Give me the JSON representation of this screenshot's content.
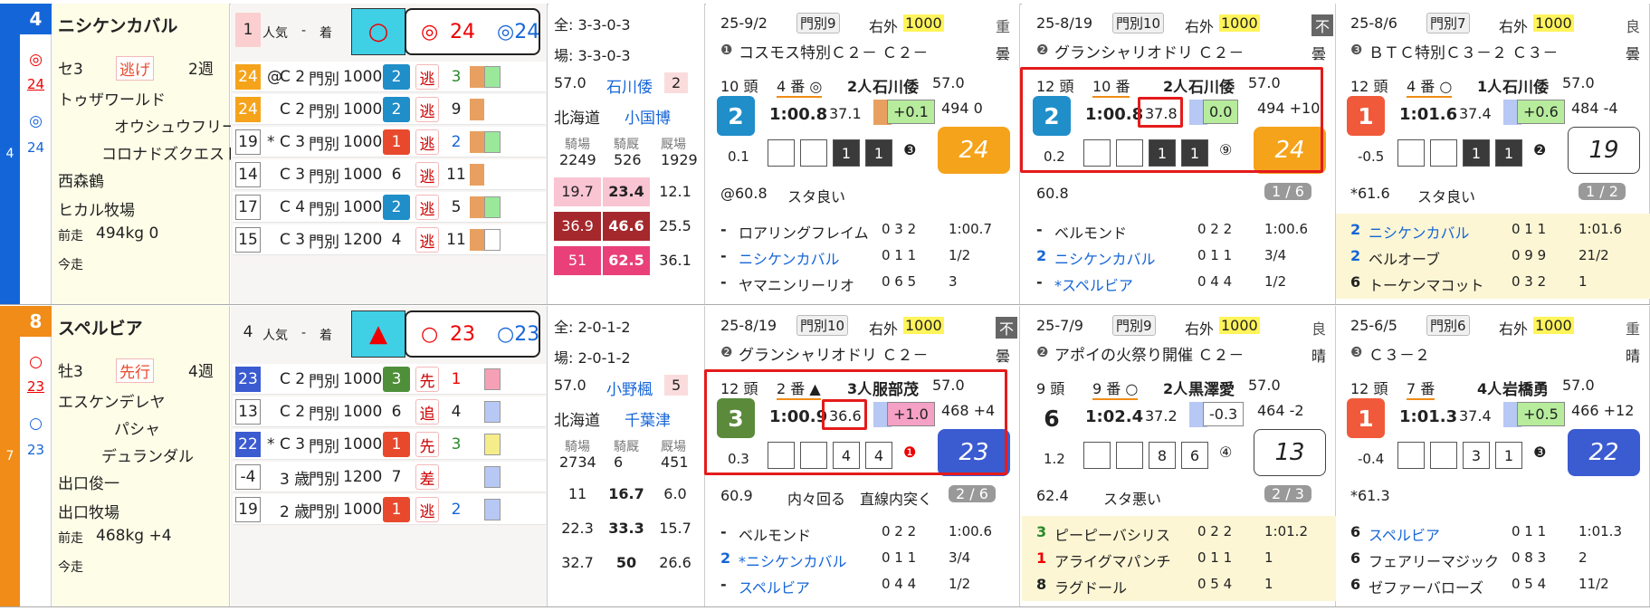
{
  "horses": [
    {
      "num": "4",
      "color": "#1466d8",
      "strip_label": "4",
      "mark": "◎",
      "mark_val": "24",
      "mark2": "◎",
      "mark2_val": "24",
      "name": "ニシケンカバル",
      "sex_age": "セ3",
      "style": "逃げ",
      "interval": "2週",
      "sire": "トゥザワールド",
      "dam": "オウシュウフリート",
      "dam_sire": "コロナドズクエスト",
      "trainer": "西森鶴",
      "owner": "ヒカル牧場",
      "weight_label": "前走",
      "weight": "494kg  0",
      "bottom_label": "今走",
      "pop": "1",
      "pop_label": "人気",
      "pop_dash": "-",
      "pop_chaku": "着",
      "pop_mark": "○",
      "big_marks": [
        "◎",
        "24",
        "◎24"
      ],
      "prev": [
        {
          "a": "24",
          "ac": "#f5a31b",
          "b": "@",
          "c": "C 2",
          "d": "門別",
          "e": "1000",
          "f": "2",
          "fc": "#1f8ec9",
          "g": "逃",
          "h": "3",
          "hc": "#2a8a2a",
          "w1": "#e8a060",
          "w2": "#9be89b"
        },
        {
          "a": "24",
          "ac": "#f5a31b",
          "b": "",
          "c": "C 2",
          "d": "門別",
          "e": "1000",
          "f": "2",
          "fc": "#1f8ec9",
          "g": "逃",
          "h": "9",
          "hc": "#222",
          "w1": "#e8a060",
          "w2": ""
        },
        {
          "a": "19",
          "ac": "",
          "b": "*",
          "c": "C 3",
          "d": "門別",
          "e": "1000",
          "f": "1",
          "fc": "#e8492c",
          "g": "逃",
          "h": "2",
          "hc": "#1565d8",
          "w1": "#e8a060",
          "w2": "#9be89b"
        },
        {
          "a": "14",
          "ac": "",
          "b": "",
          "c": "C 3",
          "d": "門別",
          "e": "1000",
          "f": "6",
          "fc": "",
          "g": "逃",
          "h": "11",
          "hc": "#222",
          "w1": "#e8a060",
          "w2": ""
        },
        {
          "a": "17",
          "ac": "",
          "b": "",
          "c": "C 4",
          "d": "門別",
          "e": "1000",
          "f": "2",
          "fc": "#1f8ec9",
          "g": "逃",
          "h": "5",
          "hc": "#222",
          "w1": "#e8a060",
          "w2": "#9be89b"
        },
        {
          "a": "15",
          "ac": "",
          "b": "",
          "c": "C 3",
          "d": "門別",
          "e": "1200",
          "f": "4",
          "fc": "",
          "g": "逃",
          "h": "11",
          "hc": "#222",
          "w1": "#e8a060",
          "w2": "#fff"
        }
      ],
      "stat": {
        "all": "全: 3-3-0-3",
        "place": "場: 3-3-0-3",
        "kg": "57.0",
        "jockey": "石川倭",
        "jnum": "2",
        "region": "北海道",
        "trainer2": "小国博",
        "h1": "騎場",
        "h2": "騎厩",
        "h3": "厩場",
        "v1": "2249",
        "v2": "526",
        "v3": "1929",
        "rows": [
          [
            "19.7",
            "23.4",
            "12.1"
          ],
          [
            "36.9",
            "46.6",
            "25.5"
          ],
          [
            "51",
            "62.5",
            "36.1"
          ]
        ]
      },
      "races": [
        {
          "date": "25-9/2",
          "cls": "門別9",
          "dist": "右外",
          "dist_n": "1000",
          "going": "重",
          "no": "❶",
          "race": "コスモス特別Ｃ２－ Ｃ２－",
          "weather": "曇",
          "heads": "10 頭",
          "gate": "4  番 ◎",
          "pop": "2人",
          "jockey": "石川倭",
          "kg": "57.0",
          "pos": "2",
          "posc": "#1f8ec9",
          "time": "1:00.8",
          "last3": "37.1",
          "diff": "+0.1",
          "diffc": "#b6ec9c",
          "bw": "494  0",
          "odds": "0.1",
          "rank": "24",
          "rankc": "#f5a31b",
          "rankt": "#fff",
          "corner": [
            "",
            "",
            "1",
            "1"
          ],
          "cmark": "❸",
          "pace": "@60.8",
          "comment": "スタ良い",
          "tag": "",
          "res": [
            [
              "-",
              "ロアリングフレイム",
              "0 3 2",
              "1:00.7"
            ],
            [
              "-",
              "ニシケンカバル",
              "0 1 1",
              "1/2"
            ],
            [
              "-",
              "ヤマニンリーリオ",
              "0 6 5",
              "3"
            ]
          ],
          "resband": ""
        },
        {
          "date": "25-8/19",
          "cls": "門別10",
          "dist": "右外",
          "dist_n": "1000",
          "going": "不",
          "no": "❷",
          "race": "グランシャリオドリ Ｃ２－",
          "weather": "曇",
          "heads": "12 頭",
          "gate": "10 番",
          "pop": "2人",
          "jockey": "石川倭",
          "kg": "57.0",
          "pos": "2",
          "posc": "#1f8ec9",
          "time": "1:00.8",
          "last3": "37.8",
          "diff": "0.0",
          "diffc": "#b6ec9c",
          "bw": "494 +10",
          "odds": "0.2",
          "rank": "24",
          "rankc": "#f5a31b",
          "rankt": "#fff",
          "corner": [
            "",
            "",
            "1",
            "1"
          ],
          "cmark": "⑨",
          "pace": "60.8",
          "comment": "",
          "tag": "1 / 6",
          "res": [
            [
              "-",
              "ベルモンド",
              "0 2 2",
              "1:00.6"
            ],
            [
              "2",
              "ニシケンカバル",
              "0 1 1",
              "3/4"
            ],
            [
              "-",
              "*スペルビア",
              "0 4 4",
              "1/2"
            ]
          ],
          "resband": ""
        },
        {
          "date": "25-8/6",
          "cls": "門別7",
          "dist": "右外",
          "dist_n": "1000",
          "going": "良",
          "no": "❸",
          "race": "ＢＴＣ特別Ｃ３－２ Ｃ３－",
          "weather": "曇",
          "heads": "12 頭",
          "gate": "4  番 ○",
          "pop": "1人",
          "jockey": "石川倭",
          "kg": "57.0",
          "pos": "1",
          "posc": "#f05a3a",
          "time": "1:01.6",
          "last3": "37.4",
          "diff": "+0.6",
          "diffc": "#b6ec9c",
          "bw": "484 -4",
          "odds": "-0.5",
          "rank": "19",
          "rankc": "#fff",
          "rankt": "#222",
          "corner": [
            "",
            "",
            "1",
            "1"
          ],
          "cmark": "❷",
          "pace": "*61.6",
          "comment": "スタ良い",
          "tag": "1 / 2",
          "res": [
            [
              "2",
              "ニシケンカバル",
              "0 1 1",
              "1:01.6"
            ],
            [
              "2",
              "ベルオーブ",
              "0 9 9",
              "21/2"
            ],
            [
              "6",
              "トーケンマコット",
              "0 3 2",
              "1"
            ]
          ],
          "resband": "#fdf6d4"
        }
      ]
    },
    {
      "num": "8",
      "color": "#f08c17",
      "strip_label": "7",
      "mark": "○",
      "mark_val": "23",
      "mark2": "○",
      "mark2_val": "23",
      "name": "スペルビア",
      "sex_age": "牡3",
      "style": "先行",
      "interval": "4週",
      "sire": "エスケンデレヤ",
      "dam": "パシャ",
      "dam_sire": "デュランダル",
      "trainer": "出口俊一",
      "owner": "出口牧場",
      "weight_label": "前走",
      "weight": "468kg  +4",
      "bottom_label": "今走",
      "pop": "4",
      "pop_label": "人気",
      "pop_dash": "-",
      "pop_chaku": "着",
      "pop_mark": "▲",
      "big_marks": [
        "○",
        "23",
        "○23"
      ],
      "prev": [
        {
          "a": "23",
          "ac": "#3b5bd1",
          "b": "",
          "c": "C 2",
          "d": "門別",
          "e": "1000",
          "f": "3",
          "fc": "#4f8f3a",
          "g": "先",
          "h": "1",
          "hc": "#e00",
          "w1": "",
          "w2": "#f5a0b5"
        },
        {
          "a": "13",
          "ac": "",
          "b": "",
          "c": "C 2",
          "d": "門別",
          "e": "1000",
          "f": "6",
          "fc": "",
          "g": "追",
          "h": "4",
          "hc": "#222",
          "w1": "",
          "w2": "#b7c8f5"
        },
        {
          "a": "22",
          "ac": "#3b5bd1",
          "b": "*",
          "c": "C 3",
          "d": "門別",
          "e": "1000",
          "f": "1",
          "fc": "#e8492c",
          "g": "先",
          "h": "3",
          "hc": "#2a8a2a",
          "w1": "",
          "w2": "#f5ec8a"
        },
        {
          "a": "-4",
          "ac": "",
          "b": "",
          "c": "3 歳",
          "d": "門別",
          "e": "1200",
          "f": "7",
          "fc": "",
          "g": "差",
          "h": "",
          "hc": "#222",
          "w1": "",
          "w2": "#b7c8f5"
        },
        {
          "a": "19",
          "ac": "",
          "b": "",
          "c": "2 歳",
          "d": "門別",
          "e": "1000",
          "f": "1",
          "fc": "#e8492c",
          "g": "逃",
          "h": "2",
          "hc": "#1565d8",
          "w1": "",
          "w2": "#b7c8f5"
        }
      ],
      "stat": {
        "all": "全: 2-0-1-2",
        "place": "場: 2-0-1-2",
        "kg": "57.0",
        "jockey": "小野楓",
        "jnum": "5",
        "region": "北海道",
        "trainer2": "千葉津",
        "h1": "騎場",
        "h2": "騎厩",
        "h3": "厩場",
        "v1": "2734",
        "v2": "6",
        "v3": "451",
        "rows": [
          [
            "11",
            "16.7",
            "6.0"
          ],
          [
            "22.3",
            "33.3",
            "15.7"
          ],
          [
            "32.7",
            "50",
            "26.6"
          ]
        ]
      },
      "races": [
        {
          "date": "25-8/19",
          "cls": "門別10",
          "dist": "右外",
          "dist_n": "1000",
          "going": "不",
          "no": "❷",
          "race": "グランシャリオドリ Ｃ２－",
          "weather": "曇",
          "heads": "12 頭",
          "gate": "2  番 ▲",
          "pop": "3人",
          "jockey": "服部茂",
          "kg": "57.0",
          "pos": "3",
          "posc": "#5a8a3a",
          "time": "1:00.9",
          "last3": "36.6",
          "diff": "+1.0",
          "diffc": "#f5a0c5",
          "bw": "468 +4",
          "odds": "0.3",
          "rank": "23",
          "rankc": "#3b5bd1",
          "rankt": "#fff",
          "corner": [
            "",
            "",
            "4",
            "4"
          ],
          "cmark": "❶",
          "pace": "60.9",
          "comment": "内々回る　直線内突く",
          "tag": "2 / 6",
          "res": [
            [
              "-",
              "ベルモンド",
              "0 2 2",
              "1:00.6"
            ],
            [
              "2",
              "*ニシケンカバル",
              "0 1 1",
              "3/4"
            ],
            [
              "-",
              "スペルビア",
              "0 4 4",
              "1/2"
            ]
          ],
          "resband": ""
        },
        {
          "date": "25-7/9",
          "cls": "門別9",
          "dist": "右外",
          "dist_n": "1000",
          "going": "良",
          "no": "❷",
          "race": "アポイの火祭り開催 Ｃ２－",
          "weather": "晴",
          "heads": "9  頭",
          "gate": "9  番 ○",
          "pop": "2人",
          "jockey": "黒澤愛",
          "kg": "57.0",
          "pos": "6",
          "posc": "",
          "time": "1:02.4",
          "last3": "37.2",
          "diff": "-0.3",
          "diffc": "#fff",
          "bw": "464 -2",
          "odds": "1.2",
          "rank": "13",
          "rankc": "#fff",
          "rankt": "#222",
          "corner": [
            "",
            "",
            "8",
            "6"
          ],
          "cmark": "④",
          "pace": "62.4",
          "comment": "スタ悪い",
          "tag": "2 / 3",
          "res": [
            [
              "3",
              "ピーピーバシリス",
              "0 2 2",
              "1:01.2"
            ],
            [
              "1",
              "アライグマパンチ",
              "0 1 1",
              "1"
            ],
            [
              "8",
              "ラグドール",
              "0 5 4",
              "1"
            ]
          ],
          "resband": "#fdf6d4"
        },
        {
          "date": "25-6/5",
          "cls": "門別6",
          "dist": "右外",
          "dist_n": "1000",
          "going": "重",
          "no": "❸",
          "race": "Ｃ３－２",
          "weather": "晴",
          "heads": "12 頭",
          "gate": "7  番",
          "pop": "4人",
          "jockey": "岩橋勇",
          "kg": "57.0",
          "pos": "1",
          "posc": "#f05a3a",
          "time": "1:01.3",
          "last3": "37.4",
          "diff": "+0.5",
          "diffc": "#b6ec9c",
          "bw": "466 +12",
          "odds": "-0.4",
          "rank": "22",
          "rankc": "#3b5bd1",
          "rankt": "#fff",
          "corner": [
            "",
            "",
            "3",
            "1"
          ],
          "cmark": "❸",
          "pace": "*61.3",
          "comment": "",
          "tag": "",
          "res": [
            [
              "6",
              "スペルビア",
              "0 1 1",
              "1:01.3"
            ],
            [
              "6",
              "フェアリーマジック",
              "0 8 3",
              "2"
            ],
            [
              "6",
              "ゼファーバローズ",
              "0 5 4",
              "11/2"
            ]
          ],
          "resband": ""
        }
      ]
    }
  ]
}
